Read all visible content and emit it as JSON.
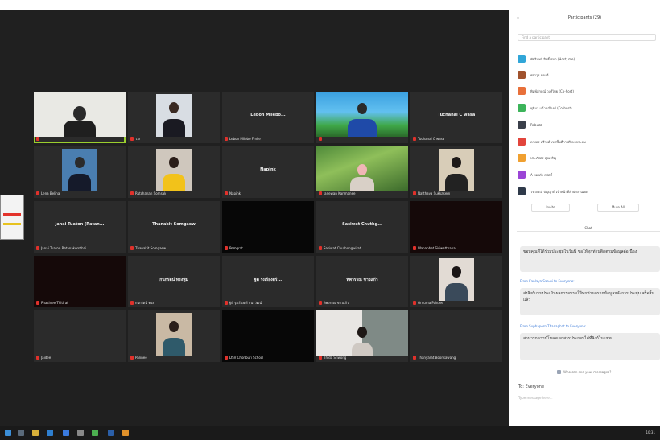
{
  "gallery": {
    "tiles": [
      {
        "name": "",
        "center": ""
      },
      {
        "name": "ว.ส",
        "center": ""
      },
      {
        "name": "Lebon Milebo Fmile",
        "center": "Lebon Milebo..."
      },
      {
        "name": "",
        "center": ""
      },
      {
        "name": "Tuchanai C wasa",
        "center": "Tuchanai C wasa"
      },
      {
        "name": "Lena Belina",
        "center": ""
      },
      {
        "name": "Rutchanan Somsak",
        "center": ""
      },
      {
        "name": "Napink",
        "center": "Napink"
      },
      {
        "name": "Janewan Kanmanee",
        "center": ""
      },
      {
        "name": "Natthaya Sukkasem",
        "center": ""
      },
      {
        "name": "Janai Tuaton Ratanakornthai",
        "center": "Janai Tuaton (Ratan..."
      },
      {
        "name": "Thanakit Somgaew",
        "center": "Thanakit Somgaew"
      },
      {
        "name": "Pemgrat",
        "center": ""
      },
      {
        "name": "Sasiwat Chuthongwirat",
        "center": "Sasiwat Chuthg..."
      },
      {
        "name": "Wanaphat Siriwatthana",
        "center": ""
      },
      {
        "name": "Phasinee Thitirat",
        "center": ""
      },
      {
        "name": "กนกรัตน์ ทรง",
        "center": "กนกรัตน์ ทรงพุ่ม"
      },
      {
        "name": "ฐิติ รุ่งเรืองศรี ธนาวัฒน์",
        "center": "ฐิติ รุ่งเรืองศรี..."
      },
      {
        "name": "ทิพวรรณ ขาวแก้ว",
        "center": "ทิพวรรณ ขาวแก้ว"
      },
      {
        "name": "Ornuma Pakdee",
        "center": ""
      },
      {
        "name": "Jaidee",
        "center": ""
      },
      {
        "name": "Pannee",
        "center": ""
      },
      {
        "name": "DSV Chonburi School",
        "center": ""
      },
      {
        "name": "Thida Sriwong",
        "center": ""
      },
      {
        "name": "Thanyarat Boonsawang",
        "center": ""
      }
    ]
  },
  "participants_panel": {
    "title": "Participants (29)",
    "search_placeholder": "Find a participant",
    "items": [
      {
        "name": "พัชรินทร์ สิทธิ์เสนา (Host, me)",
        "color": "#31a6d8"
      },
      {
        "name": "ศราวุธ ทองดี",
        "color": "#a0522d"
      },
      {
        "name": "พิมพ์ลักษณ์ วงศ์ไทย (Co-host)",
        "color": "#e8703a"
      },
      {
        "name": "ชุติมา แก้วมณีวงศ์ (Co-host)",
        "color": "#3cb45a"
      },
      {
        "name": "Rebuzz",
        "color": "#3a3f4a"
      },
      {
        "name": "ดวงพร ศรีวงศ์ เขตพื้นที่การศึกษาประถม",
        "color": "#e2453c"
      },
      {
        "name": "ประภัสสร สุขเจริญ",
        "color": "#f0a030"
      },
      {
        "name": "A ทองคำ สวัสดิ์",
        "color": "#9b45d6"
      },
      {
        "name": "วราภรณ์ ปัญญาดี เจ้าหน้าที่สำนักงานเขต",
        "color": "#2f3a4a"
      }
    ],
    "invite_label": "Invite",
    "mute_all_label": "Mute All"
  },
  "chat": {
    "header": "Chat",
    "messages": [
      {
        "from": "",
        "text": "ขอบคุณที่ได้ร่วมประชุมในวันนี้ ขอให้ทุกท่านติดตามข้อมูลต่อเนื่อง"
      },
      {
        "from": "From Kanlaya Sae-ui to Everyone:",
        "text": "ส่งลิงก์แบบประเมินผลการอบรมให้ทุกท่านกรอกข้อมูลหลังการประชุมเสร็จสิ้นแล้ว"
      },
      {
        "from": "From Suphaporn Thanaphat to Everyone:",
        "text": "สามารถดาวน์โหลดเอกสารประกอบได้ที่ลิงก์ในแชท"
      }
    ],
    "to_label": "Who can see your messages?",
    "recipient": "To: Everyone",
    "input_placeholder": "Type message here..."
  },
  "taskbar": {
    "clock": "10:31"
  }
}
